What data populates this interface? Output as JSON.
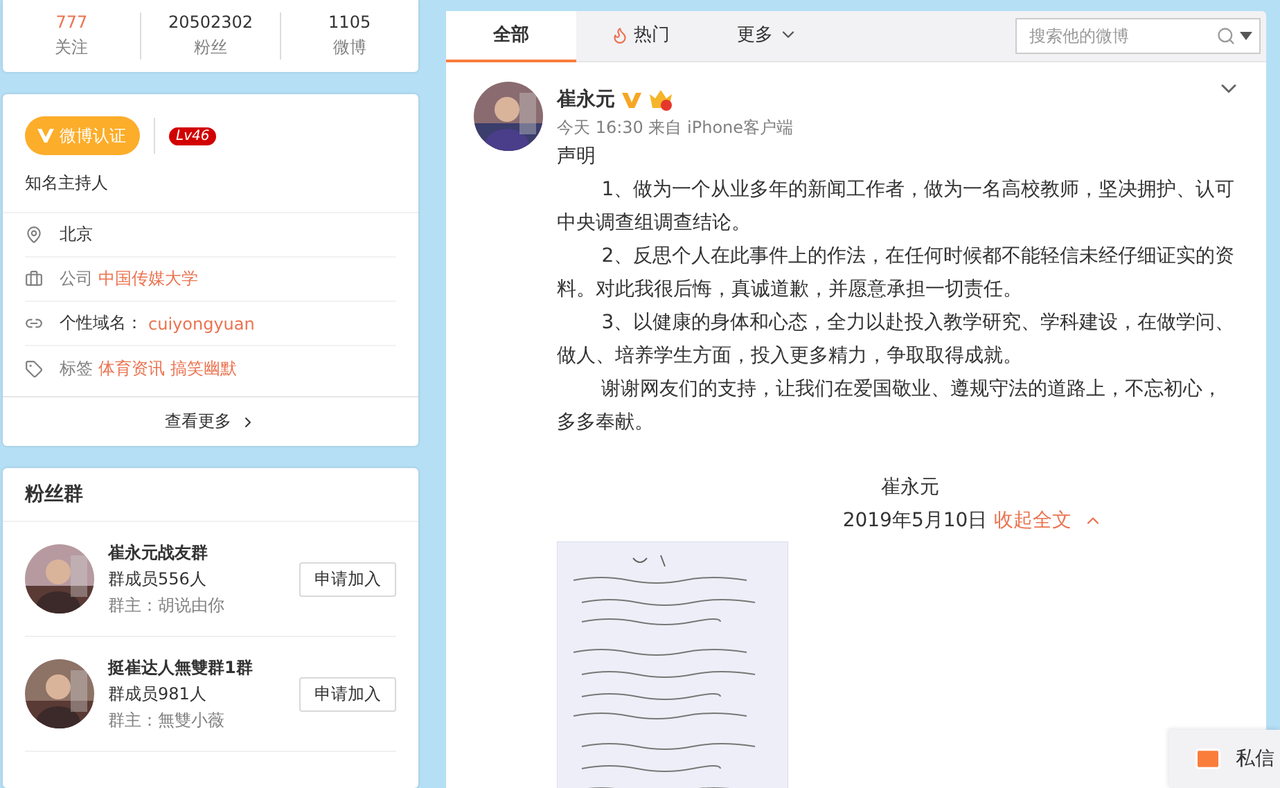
{
  "profile_stats": [
    {
      "value": "777",
      "label": "关注",
      "highlight": true
    },
    {
      "value": "20502302",
      "label": "粉丝",
      "highlight": false
    },
    {
      "value": "1105",
      "label": "微博",
      "highlight": false
    }
  ],
  "verification": {
    "badge": "微博认证",
    "level": "Lv46",
    "description": "知名主持人"
  },
  "info_items": [
    {
      "kind": "location",
      "label": "北京"
    },
    {
      "kind": "company",
      "label": "公司",
      "values": [
        "中国传媒大学"
      ]
    },
    {
      "kind": "link",
      "label": "个性域名：",
      "values": [
        "cuiyongyuan"
      ]
    },
    {
      "kind": "tag",
      "label": "标签",
      "values": [
        "体育资讯",
        "搞笑幽默"
      ]
    }
  ],
  "see_more": "查看更多",
  "fan_groups": {
    "title": "粉丝群",
    "groups": [
      {
        "name": "崔永元战友群",
        "members": "群成员556人",
        "owner": "群主：胡说由你",
        "button": "申请加入"
      },
      {
        "name": "挺崔达人無雙群1群",
        "members": "群成员981人",
        "owner": "群主：無雙小薇",
        "button": "申请加入"
      }
    ]
  },
  "feed_tabs": [
    {
      "label": "全部",
      "selected": true,
      "kind": "plain"
    },
    {
      "label": "热门",
      "selected": false,
      "kind": "hot"
    },
    {
      "label": "更多",
      "selected": false,
      "kind": "dropdown"
    }
  ],
  "search": {
    "placeholder": "搜索他的微博"
  },
  "post": {
    "author": "崔永元",
    "verified": true,
    "member": true,
    "time": "今天 16:30 来自 iPhone客户端",
    "paragraphs": [
      {
        "kind": "heading",
        "text": "声明"
      },
      {
        "kind": "indented",
        "text": "1、做为一个从业多年的新闻工作者，做为一名高校教师，坚决拥护、认可中央调查组调查结论。"
      },
      {
        "kind": "indented",
        "text": "2、反思个人在此事件上的作法，在任何时候都不能轻信未经仔细证实的资料。对此我很后悔，真诚道歉，并愿意承担一切责任。"
      },
      {
        "kind": "indented",
        "text": "3、以健康的身体和心态，全力以赴投入教学研究、学科建设，在做学问、做人、培养学生方面，投入更多精力，争取取得成就。"
      },
      {
        "kind": "indented",
        "text": "谢谢网友们的支持，让我们在爱国敬业、遵规守法的道路上，不忘初心，多多奉献。"
      }
    ],
    "signature": "崔永元",
    "date": "2019年5月10日",
    "collapse_link": "收起全文"
  },
  "message_widget": {
    "label": "私信"
  }
}
